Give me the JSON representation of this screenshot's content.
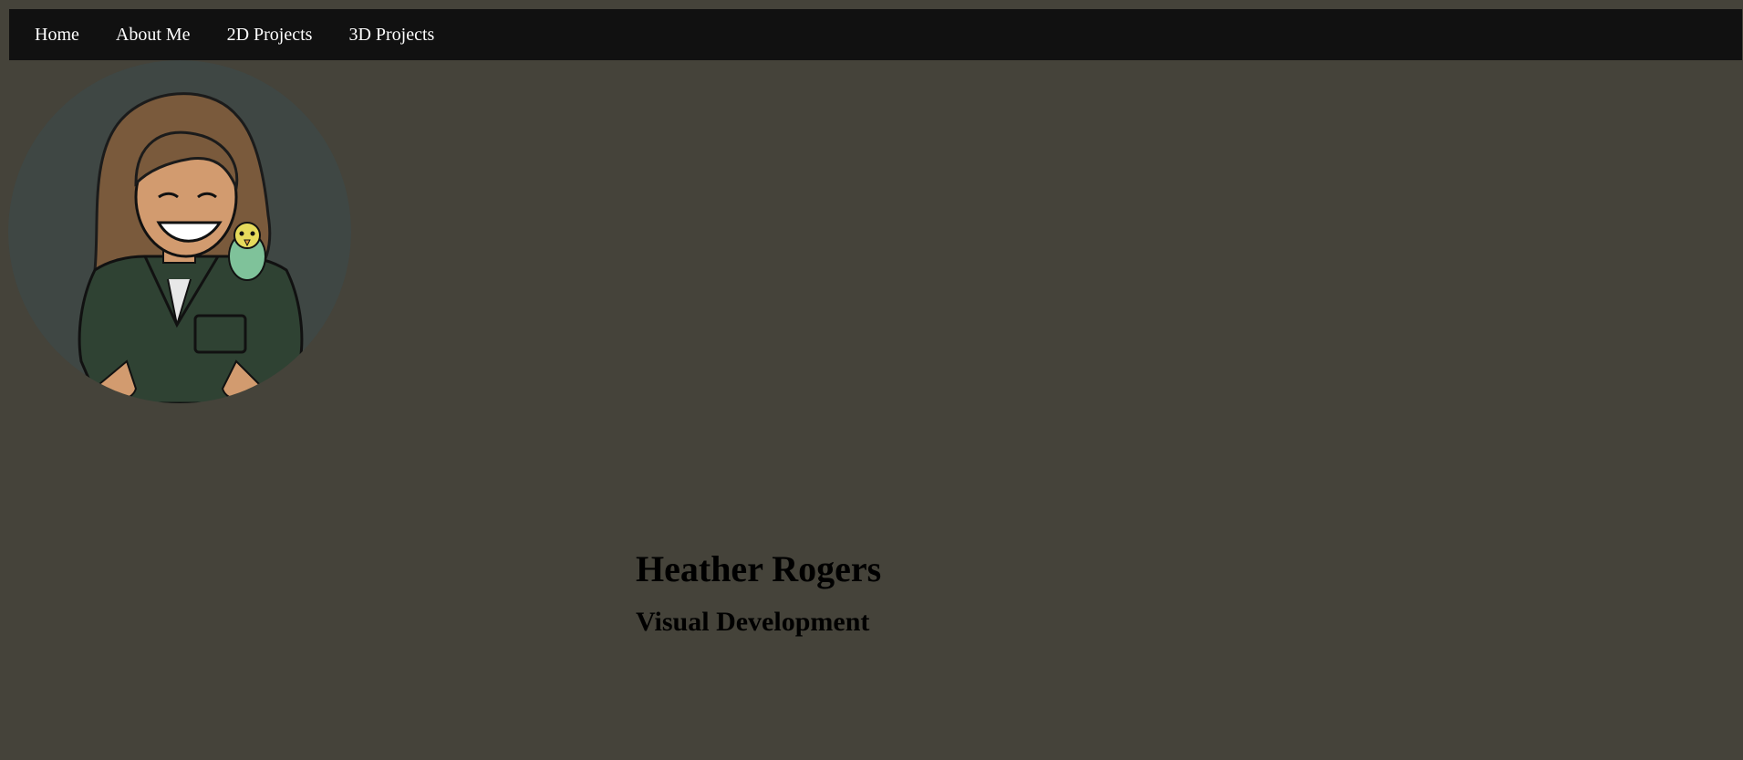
{
  "nav": {
    "items": [
      {
        "label": "Home"
      },
      {
        "label": "About Me"
      },
      {
        "label": "2D Projects"
      },
      {
        "label": "3D Projects"
      }
    ]
  },
  "avatar": {
    "icon": "portrait-illustration"
  },
  "hero": {
    "name": "Heather Rogers",
    "role": "Visual Development"
  },
  "colors": {
    "page_background": "#45433a",
    "navbar_background": "#111111",
    "nav_text": "#ffffff",
    "heading_text": "#000000",
    "avatar_background": "#3f4744"
  }
}
